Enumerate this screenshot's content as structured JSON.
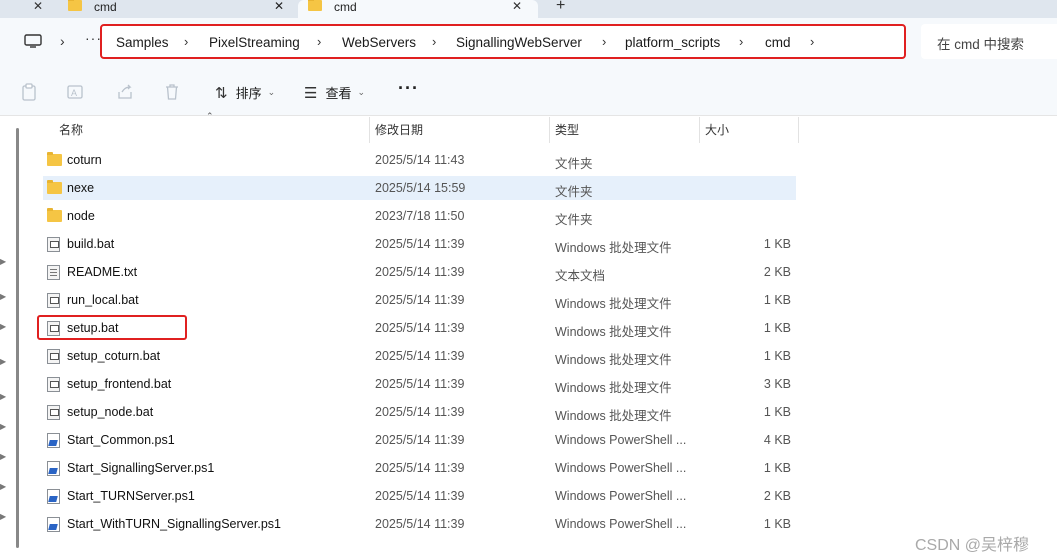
{
  "tabs": [
    {
      "label": "cmd",
      "active": false
    },
    {
      "label": "cmd",
      "active": true
    }
  ],
  "new_tab_label": "+",
  "breadcrumbs": [
    "Samples",
    "PixelStreaming",
    "WebServers",
    "SignallingWebServer",
    "platform_scripts",
    "cmd"
  ],
  "search": {
    "placeholder": "在 cmd 中搜索"
  },
  "toolbar": {
    "sort_label": "排序",
    "view_label": "查看",
    "more_label": "···"
  },
  "columns": {
    "name": "名称",
    "date": "修改日期",
    "type": "类型",
    "size": "大小"
  },
  "files": [
    {
      "name": "coturn",
      "date": "2025/5/14 11:43",
      "type": "文件夹",
      "size": "",
      "kind": "folder"
    },
    {
      "name": "nexe",
      "date": "2025/5/14 15:59",
      "type": "文件夹",
      "size": "",
      "kind": "folder"
    },
    {
      "name": "node",
      "date": "2023/7/18 11:50",
      "type": "文件夹",
      "size": "",
      "kind": "folder"
    },
    {
      "name": "build.bat",
      "date": "2025/5/14 11:39",
      "type": "Windows 批处理文件",
      "size": "1 KB",
      "kind": "bat"
    },
    {
      "name": "README.txt",
      "date": "2025/5/14 11:39",
      "type": "文本文档",
      "size": "2 KB",
      "kind": "txt"
    },
    {
      "name": "run_local.bat",
      "date": "2025/5/14 11:39",
      "type": "Windows 批处理文件",
      "size": "1 KB",
      "kind": "bat"
    },
    {
      "name": "setup.bat",
      "date": "2025/5/14 11:39",
      "type": "Windows 批处理文件",
      "size": "1 KB",
      "kind": "bat"
    },
    {
      "name": "setup_coturn.bat",
      "date": "2025/5/14 11:39",
      "type": "Windows 批处理文件",
      "size": "1 KB",
      "kind": "bat"
    },
    {
      "name": "setup_frontend.bat",
      "date": "2025/5/14 11:39",
      "type": "Windows 批处理文件",
      "size": "3 KB",
      "kind": "bat"
    },
    {
      "name": "setup_node.bat",
      "date": "2025/5/14 11:39",
      "type": "Windows 批处理文件",
      "size": "1 KB",
      "kind": "bat"
    },
    {
      "name": "Start_Common.ps1",
      "date": "2025/5/14 11:39",
      "type": "Windows PowerShell ...",
      "size": "4 KB",
      "kind": "ps1"
    },
    {
      "name": "Start_SignallingServer.ps1",
      "date": "2025/5/14 11:39",
      "type": "Windows PowerShell ...",
      "size": "1 KB",
      "kind": "ps1"
    },
    {
      "name": "Start_TURNServer.ps1",
      "date": "2025/5/14 11:39",
      "type": "Windows PowerShell ...",
      "size": "2 KB",
      "kind": "ps1"
    },
    {
      "name": "Start_WithTURN_SignallingServer.ps1",
      "date": "2025/5/14 11:39",
      "type": "Windows PowerShell ...",
      "size": "1 KB",
      "kind": "ps1"
    }
  ],
  "selected_index": 1,
  "watermark": "CSDN @吴梓穆",
  "colors": {
    "highlight_border": "#e02020",
    "selected_row": "#e6f0fb",
    "folder": "#f5c544"
  }
}
